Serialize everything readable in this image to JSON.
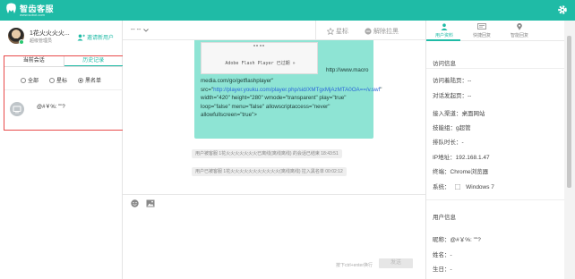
{
  "app": {
    "name": "智齿客服",
    "name_sub": "www.sobot.com",
    "accent": "#1fbba6",
    "settings_icon": "gear-icon"
  },
  "agent": {
    "name": "1花火火火火...",
    "status": "超级管理员",
    "invite_label": "邀请新用户"
  },
  "left": {
    "tabs": [
      "当前会话",
      "历史记录"
    ],
    "filters": [
      "全部",
      "星标",
      "黑名单"
    ],
    "selected_filter": "黑名单",
    "conversation": {
      "text": "@#￥%: \"\"?"
    }
  },
  "chat": {
    "dropdown_label": "-- --",
    "star_label": "星标",
    "unbind_label": "解除拉黑",
    "flash_text": "Adobe Flash Player 已过期 »",
    "message_suffix": "http://www.macro",
    "message_line1": "media.com/go/getflashplayer\" src=\"",
    "message_link": "http://player.youku.com/player.php/sid/XMTgxMjAzMTA0OA==/v.swf",
    "message_line2": "\" width=\"420\" height=\"280\" wmode=\"transparent\" play=\"true\" loop=\"false\" menu=\"false\" allowscriptaccess=\"never\" allowfullscreen=\"true\">",
    "system_messages": [
      "用户被客服 1花火火火火火火火已离线(离线离线) 的会话已结束 18:43:51",
      "用户已被客服 1花火火火火火火火火火火火(离线离线) 拉入黑名单 00:02:12"
    ],
    "send_hint": "按下ctrl+enter换行",
    "send_label": "发送"
  },
  "right": {
    "tabs": [
      "用户资料",
      "快捷回复",
      "智能回复"
    ],
    "visit_title": "访问信息",
    "visit_info": [
      {
        "label": "访问着陆页：",
        "value": "--"
      },
      {
        "label": "对话发起页：",
        "value": "--"
      },
      {
        "label": "接入渠道：",
        "value": "桌面网站"
      },
      {
        "label": "技能组：",
        "value": "g超管"
      },
      {
        "label": "排队时长：",
        "value": "-"
      },
      {
        "label": "IP地址：",
        "value": "192.168.1.47"
      },
      {
        "label": "终端：",
        "value": "Chrome浏览器"
      },
      {
        "label": "系统：",
        "value": "Windows 7"
      }
    ],
    "user_title": "用户信息",
    "user_info": [
      {
        "label": "昵称：",
        "value": "@#￥%: \"\"?"
      },
      {
        "label": "姓名：",
        "value": "-"
      },
      {
        "label": "生日：",
        "value": "-"
      }
    ]
  }
}
